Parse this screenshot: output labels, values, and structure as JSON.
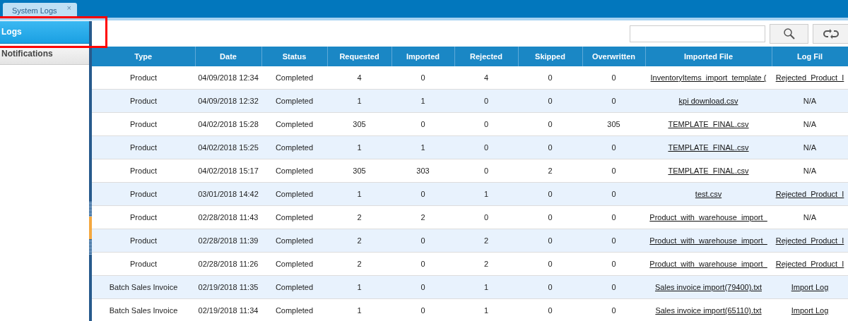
{
  "tabs": [
    {
      "label": "System Logs",
      "close": "×",
      "selected": true
    }
  ],
  "sidebar": {
    "items": [
      {
        "label": "Logs",
        "selected": true
      },
      {
        "label": "Notifications",
        "selected": false
      }
    ]
  },
  "table": {
    "columns": [
      "Type",
      "Date",
      "Status",
      "Requested",
      "Imported",
      "Rejected",
      "Skipped",
      "Overwritten",
      "Imported File",
      "Log Fil"
    ],
    "rows": [
      [
        "Product",
        "04/09/2018 12:34",
        "Completed",
        "4",
        "0",
        "4",
        "0",
        "0",
        "InventoryItems_import_template (",
        "Rejected_Product_I"
      ],
      [
        "Product",
        "04/09/2018 12:32",
        "Completed",
        "1",
        "1",
        "0",
        "0",
        "0",
        "kpi download.csv",
        "N/A"
      ],
      [
        "Product",
        "04/02/2018 15:28",
        "Completed",
        "305",
        "0",
        "0",
        "0",
        "305",
        "TEMPLATE_FINAL.csv",
        "N/A"
      ],
      [
        "Product",
        "04/02/2018 15:25",
        "Completed",
        "1",
        "1",
        "0",
        "0",
        "0",
        "TEMPLATE_FINAL.csv",
        "N/A"
      ],
      [
        "Product",
        "04/02/2018 15:17",
        "Completed",
        "305",
        "303",
        "0",
        "2",
        "0",
        "TEMPLATE_FINAL.csv",
        "N/A"
      ],
      [
        "Product",
        "03/01/2018 14:42",
        "Completed",
        "1",
        "0",
        "1",
        "0",
        "0",
        "test.csv",
        "Rejected_Product_I"
      ],
      [
        "Product",
        "02/28/2018 11:43",
        "Completed",
        "2",
        "2",
        "0",
        "0",
        "0",
        "Product_with_warehouse_import_",
        "N/A"
      ],
      [
        "Product",
        "02/28/2018 11:39",
        "Completed",
        "2",
        "0",
        "2",
        "0",
        "0",
        "Product_with_warehouse_import_",
        "Rejected_Product_I"
      ],
      [
        "Product",
        "02/28/2018 11:26",
        "Completed",
        "2",
        "0",
        "2",
        "0",
        "0",
        "Product_with_warehouse_import_",
        "Rejected_Product_I"
      ],
      [
        "Batch Sales Invoice",
        "02/19/2018 11:35",
        "Completed",
        "1",
        "0",
        "1",
        "0",
        "0",
        "Sales invoice import(79400).txt",
        "Import Log"
      ],
      [
        "Batch Sales Invoice",
        "02/19/2018 11:34",
        "Completed",
        "1",
        "0",
        "1",
        "0",
        "0",
        "Sales invoice import(65110).txt",
        "Import Log"
      ]
    ]
  }
}
